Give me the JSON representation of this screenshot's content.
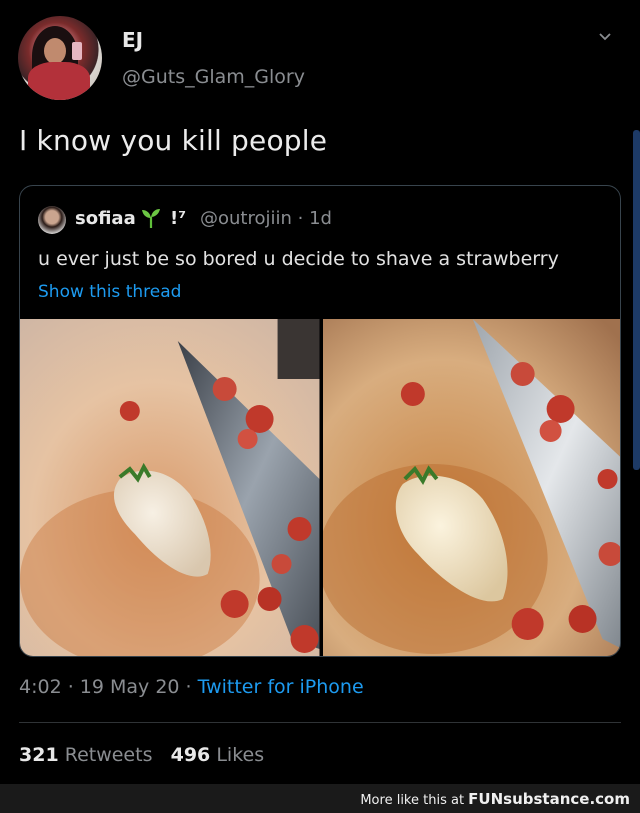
{
  "author": {
    "name": "EJ",
    "handle": "@Guts_Glam_Glory"
  },
  "tweet": {
    "text": "I know you kill people"
  },
  "quoted": {
    "name": "sofiaa",
    "emoji_suffix": "!⁷",
    "handle": "@outrojiin · 1d",
    "text": "u ever just be so bored u decide to shave a strawberry",
    "show_thread": "Show this thread"
  },
  "meta": {
    "time": "4:02 · 19 May 20 · ",
    "app": "Twitter for iPhone"
  },
  "stats": {
    "retweets": "321",
    "retweets_label": "Retweets",
    "likes": "496",
    "likes_label": "Likes"
  },
  "footer": {
    "prefix": "More like this at ",
    "brand": "FUNsubstance.com"
  },
  "icons": {
    "menu": "chevron-down-icon",
    "sprout": "sprout-emoji-icon"
  },
  "colors": {
    "link": "#1d9bf0",
    "muted": "#8a8d91",
    "border": "#38444d"
  }
}
